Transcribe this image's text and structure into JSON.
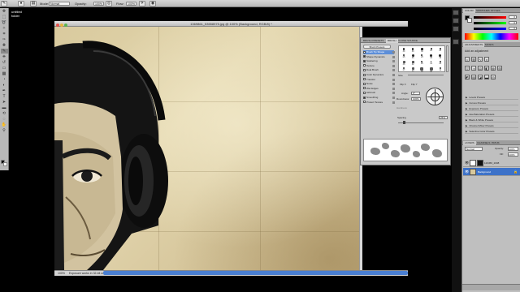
{
  "options_bar": {
    "mode_label": "Mode:",
    "mode_value": "Normal",
    "opacity_label": "Opacity:",
    "opacity_value": "100%",
    "flow_label": "Flow:",
    "flow_value": "100%"
  },
  "desktop": {
    "folder_line1": "untitled",
    "folder_line2": "folder"
  },
  "document": {
    "title": "1369861_53558975.jpg @ 100% (Background, RGB/8) *",
    "zoom": "100%",
    "status_text": "Exposure works in 32-bit only"
  },
  "brush_panel": {
    "tabs": [
      "BRUSH PRESETS",
      "BRUSH",
      "CLONE SOURCE"
    ],
    "active_tab": "BRUSH",
    "presets_button": "Brush Presets",
    "options": [
      {
        "label": "Brush Tip Shape",
        "checked": false,
        "selected": true
      },
      {
        "label": "Shape Dynamics",
        "checked": true,
        "selected": false
      },
      {
        "label": "Scattering",
        "checked": true,
        "selected": false
      },
      {
        "label": "Texture",
        "checked": false,
        "selected": false
      },
      {
        "label": "Dual Brush",
        "checked": false,
        "selected": false
      },
      {
        "label": "Color Dynamics",
        "checked": false,
        "selected": false
      },
      {
        "label": "Transfer",
        "checked": false,
        "selected": false
      },
      {
        "label": "Noise",
        "checked": false,
        "selected": false
      },
      {
        "label": "Wet Edges",
        "checked": false,
        "selected": false
      },
      {
        "label": "Airbrush",
        "checked": false,
        "selected": false
      },
      {
        "label": "Smoothing",
        "checked": true,
        "selected": false
      },
      {
        "label": "Protect Texture",
        "checked": false,
        "selected": false
      }
    ],
    "tip_sizes": [
      "30",
      "30",
      "30",
      "25",
      "25",
      "25",
      "36",
      "25",
      "36",
      "36",
      "36",
      "32",
      "25",
      "14",
      "24",
      "27",
      "39",
      "46",
      "59",
      "11"
    ],
    "size_label": "Size",
    "flip_x": "Flip X",
    "flip_y": "Flip Y",
    "angle_label": "Angle:",
    "angle_value": "0°",
    "roundness_label": "Roundness:",
    "roundness_value": "100%",
    "hardness_label": "Hardness",
    "spacing_label": "Spacing",
    "spacing_value": "25%"
  },
  "right_panels": {
    "color_tabs": [
      "COLOR",
      "SWATCHES",
      "STYLES"
    ],
    "color_values": [
      "0",
      "0",
      "0"
    ],
    "adjust_tabs": [
      "ADJUSTMENTS",
      "MASKS"
    ],
    "adjust_heading": "Add an adjustment",
    "presets": [
      "Levels Presets",
      "Curves Presets",
      "Exposure Presets",
      "Hue/Saturation Presets",
      "Black & White Presets",
      "Channel Mixer Presets",
      "Selective Color Presets"
    ],
    "layer_tabs": [
      "LAYERS",
      "CHANNELS",
      "PATHS"
    ],
    "blend_mode": "Normal",
    "opacity_label": "Opacity:",
    "opacity_value": "100%",
    "fill_label": "Fill:",
    "fill_value": "100%",
    "layers": [
      {
        "name": "123456_2008",
        "selected": false
      },
      {
        "name": "Background",
        "selected": true
      }
    ]
  },
  "colors": {
    "accent": "#5c8ed9",
    "paper": "#dccc9f",
    "layer_selected": "#3d72c9"
  }
}
